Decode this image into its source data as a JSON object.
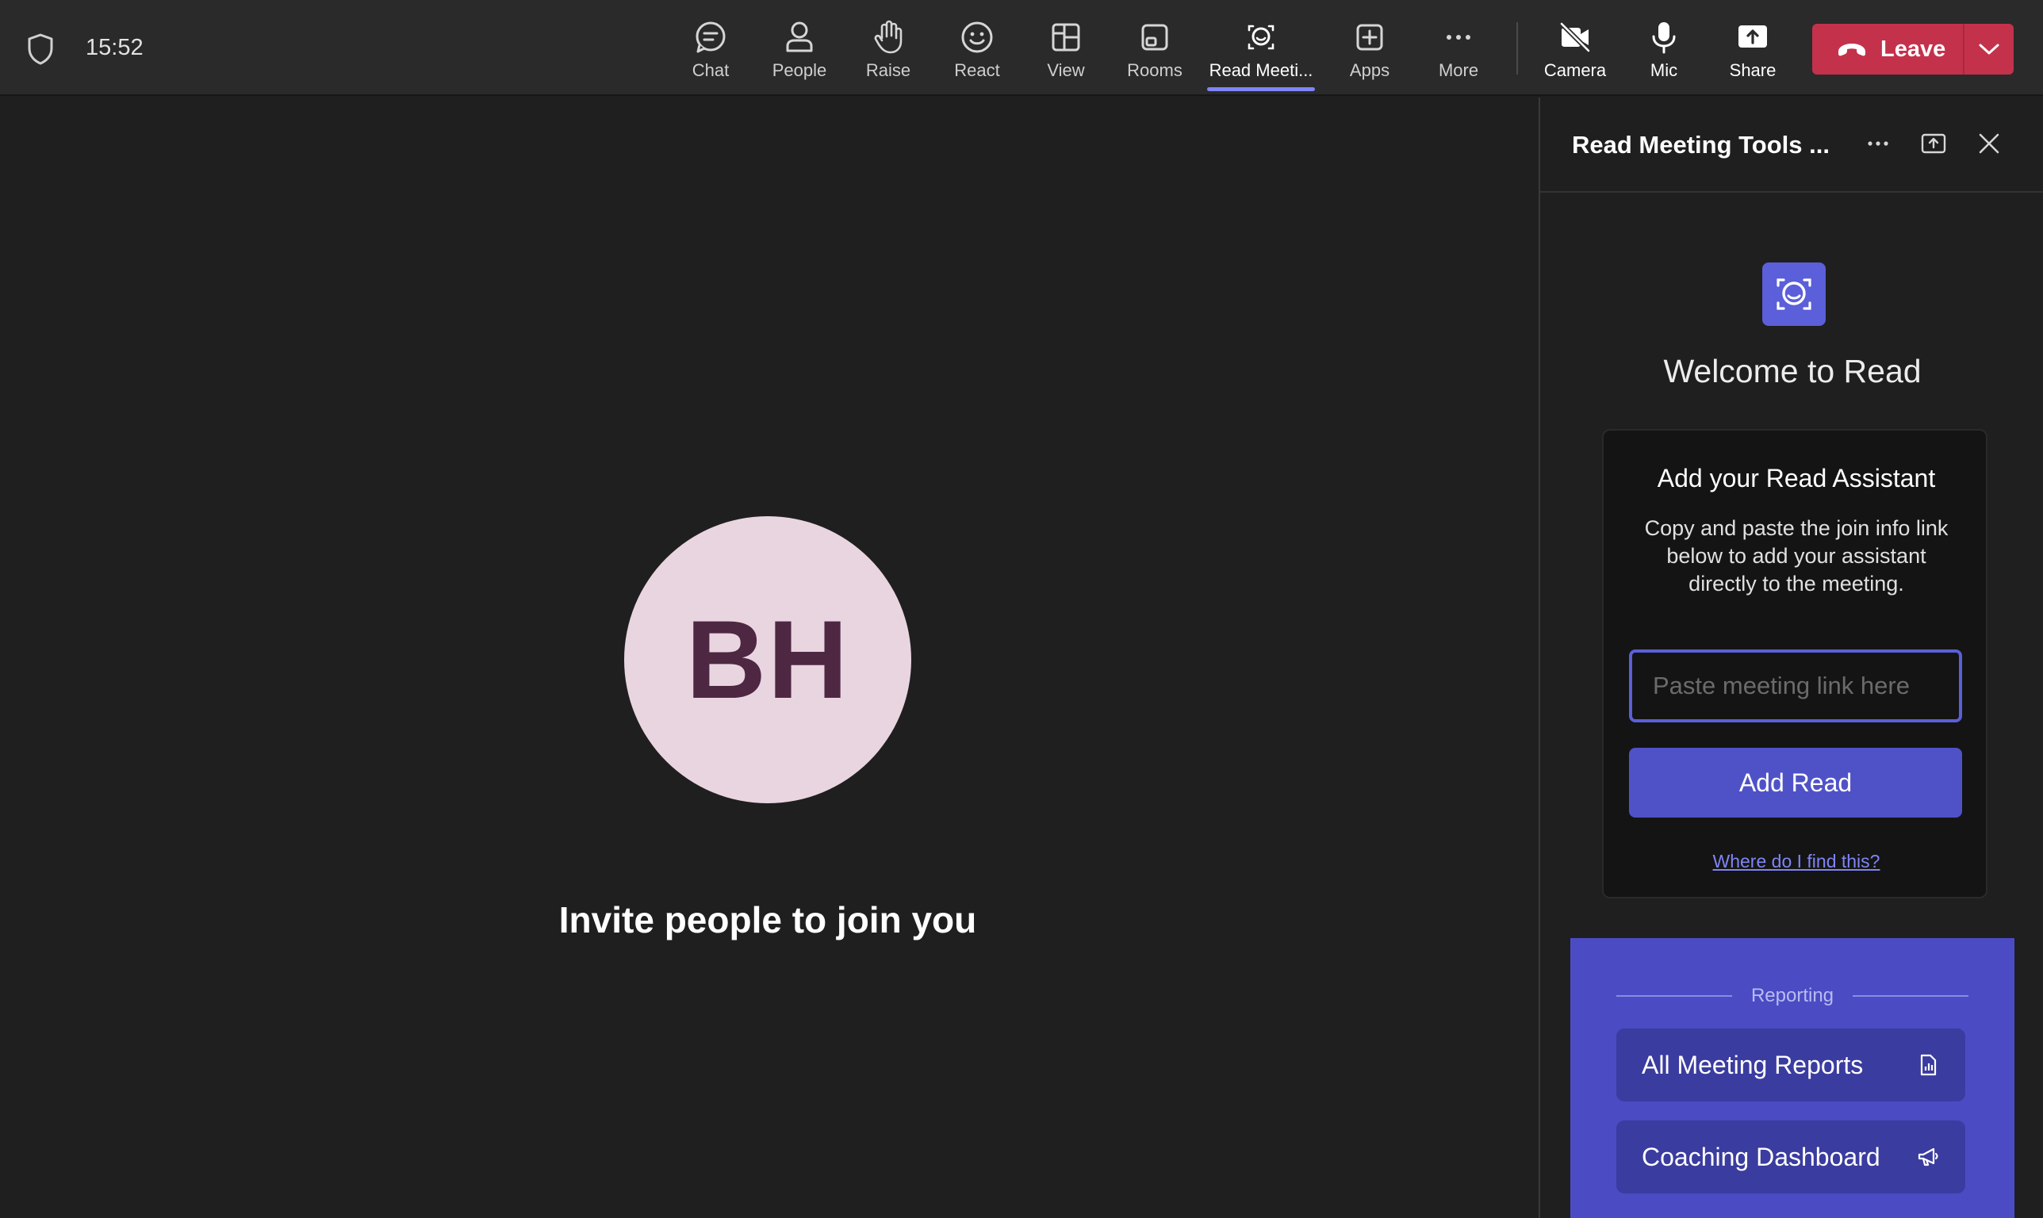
{
  "topbar": {
    "time": "15:52",
    "buttons": [
      {
        "id": "chat",
        "label": "Chat",
        "icon": "chat-icon"
      },
      {
        "id": "people",
        "label": "People",
        "icon": "people-icon"
      },
      {
        "id": "raise",
        "label": "Raise",
        "icon": "hand-icon"
      },
      {
        "id": "react",
        "label": "React",
        "icon": "smiley-icon"
      },
      {
        "id": "view",
        "label": "View",
        "icon": "layout-icon"
      },
      {
        "id": "rooms",
        "label": "Rooms",
        "icon": "rooms-icon"
      },
      {
        "id": "read",
        "label": "Read Meeti...",
        "icon": "read-app-icon",
        "active": true
      },
      {
        "id": "apps",
        "label": "Apps",
        "icon": "plus-square-icon"
      },
      {
        "id": "more",
        "label": "More",
        "icon": "ellipsis-icon"
      },
      {
        "id": "camera",
        "label": "Camera",
        "icon": "camera-off-icon"
      },
      {
        "id": "mic",
        "label": "Mic",
        "icon": "mic-icon"
      },
      {
        "id": "share",
        "label": "Share",
        "icon": "share-icon"
      }
    ],
    "leave_label": "Leave",
    "accent": "#7f85f5",
    "leave_color": "#c4314b"
  },
  "stage": {
    "initials": "BH",
    "invite_text": "Invite people to join you"
  },
  "panel": {
    "title": "Read Meeting Tools ...",
    "welcome": "Welcome to Read",
    "assistant": {
      "title": "Add your Read Assistant",
      "description": "Copy and paste the join info link below to add your assistant directly to the meeting.",
      "input_value": "",
      "input_placeholder": "Paste meeting link here",
      "button_label": "Add Read",
      "help_link": "Where do I find this?"
    },
    "reporting": {
      "label": "Reporting",
      "items": [
        {
          "label": "All Meeting Reports",
          "icon": "report-doc-icon"
        },
        {
          "label": "Coaching Dashboard",
          "icon": "megaphone-icon"
        }
      ]
    },
    "brand_color": "#5b5fd9"
  }
}
